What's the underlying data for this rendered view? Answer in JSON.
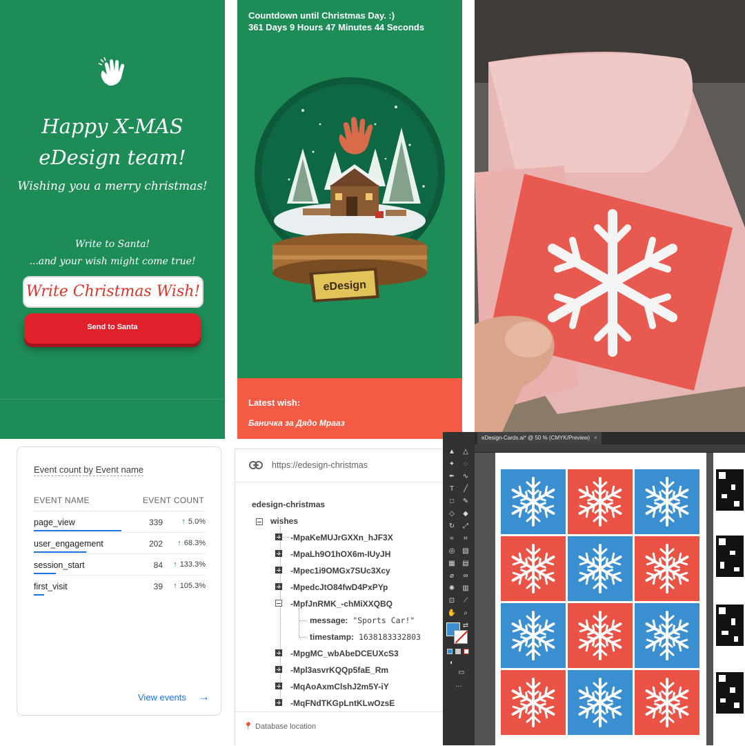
{
  "xmas_app": {
    "title_line1": "Happy X-MAS",
    "title_line2": "eDesign team!",
    "subtitle": "Wishing you a merry christmas!",
    "santa_line1": "Write to Santa!",
    "santa_line2": "...and your wish might come true!",
    "wish_placeholder": "Write Christmas Wish!",
    "send_button": "Send to Santa",
    "icon": "waving-hand-icon"
  },
  "countdown_app": {
    "title": "Countdown until Christmas Day. :)",
    "time_left": "361 Days 9 Hours 47 Minutes 44 Seconds",
    "globe_label": "eDesign",
    "latest_label": "Latest wish:",
    "latest_value": "Баничка за Дядо Мрааз",
    "colors": {
      "green": "#1e8c57",
      "coral": "#f55a44"
    }
  },
  "analytics": {
    "card_title_part1": "Event count",
    "card_title_by": "by",
    "card_title_part2": "Event name",
    "col_name": "EVENT NAME",
    "col_count": "EVENT COUNT",
    "rows": [
      {
        "name": "page_view",
        "count": "339",
        "change": "5.0%",
        "bar": 1.0
      },
      {
        "name": "user_engagement",
        "count": "202",
        "change": "68.3%",
        "bar": 0.6
      },
      {
        "name": "session_start",
        "count": "84",
        "change": "133.3%",
        "bar": 0.25
      },
      {
        "name": "first_visit",
        "count": "39",
        "change": "105.3%",
        "bar": 0.12
      }
    ],
    "view_events": "View events"
  },
  "database": {
    "url": "https://edesign-christmas",
    "root": "edesign-christmas",
    "child": "wishes",
    "keys": [
      "-MpaKeMUJrGXXn_hJF3X",
      "-MpaLh9O1hOX6m-IUyJH",
      "-Mpec1i9OMGx7SUc3Xcy",
      "-MpedcJtO84fwD4PxPYp",
      "-MpfJnRMK_-chMiXXQBQ",
      "-MpgMC_wbAbeDCEUXcS3",
      "-Mpl3asvrKQQp5faE_Rm",
      "-MqAoAxmClshJ2m5Y-iY",
      "-MqFNdTKGpLntKLwOzsE"
    ],
    "expanded_message_key": "message:",
    "expanded_message_value": "\"Sports Car!\"",
    "expanded_timestamp_key": "timestamp:",
    "expanded_timestamp_value": "1638183332803",
    "footer": "Database location"
  },
  "illustrator": {
    "tab_title": "eDesign-Cards.ai* @ 50 % (CMYK/Preview)",
    "tab_close": "×",
    "tile_colors": [
      "blue",
      "red",
      "blue",
      "red",
      "blue",
      "red",
      "blue",
      "red",
      "blue",
      "red",
      "blue",
      "red"
    ],
    "colors": {
      "blue": "#3a8fd1",
      "red": "#ea5246"
    }
  }
}
